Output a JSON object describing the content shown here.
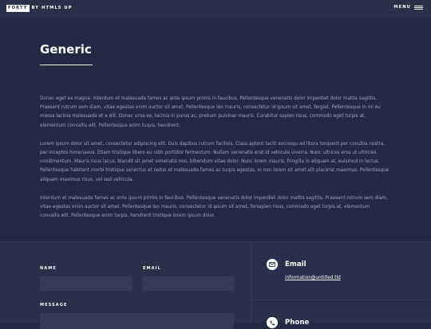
{
  "header": {
    "logo_box": "FORTY",
    "logo_tail": "BY HTML5 UP",
    "menu_label": "MENU"
  },
  "main": {
    "title": "Generic",
    "paragraphs": [
      "Donec eget ex magna. Interdum et malesuada fames ac ante ipsum primis in faucibus. Pellentesque venenatis dolor imperdiet dolor mattis sagittis. Praesent rutrum sem diam, vitae egestas enim auctor sit amet. Pellentesque leo mauris, consectetur id ipsum sit amet, fergiat. Pellentesque in mi eu massa lacinia malesuada et a elit. Donec urna ex, lacinia in purus ac, pretium pulvinar mauris. Curabitur sapien risus, commodo eget turpis at, elementum convallis elit. Pellentesque enim turpis, hendrerit.",
      "Lorem ipsum dolor sit amet, consectetur adipiscing elit. Duis dapibus rutrum facilisis. Class aptent taciti sociosqu ad litora torquent per conubia nostra, per inceptos himenaeos. Etiam tristique libero eu nibh porttitor fermentum. Nullam venenatis erat id vehicula viverra. Nunc ultrices eros ut ultricies condimentum. Mauris risus lacus, blandit sit amet venenatis non, bibendum vitae dolor. Nunc lorem mauris, fringilla in aliquam at, euismod in lectus. Pellentesque habitant morbi tristique senectus et netus et malesuada fames ac turpis egestas. In non lorem sit amet elit placerat maximus. Pellentesque aliquam maximus risus, vel sed vehicula.",
      "Interdum et malesuada fames ac ante ipsum primis in faucibus. Pellentesque venenatis dolor imperdiet dolor mattis sagittis. Praesent rutrum sem diam, vitae egestas enim auctor sit amet. Pellentesque leo mauris, consectetur id ipsum sit amet, fersapien risus, commodo eget turpis at, elementum convallis elit. Pellentesque enim turpis, hendrerit tristique lorem ipsum dolor."
    ]
  },
  "contact": {
    "name_label": "NAME",
    "email_label": "EMAIL",
    "message_label": "MESSAGE",
    "info": [
      {
        "icon": "envelope-icon",
        "title": "Email",
        "link": "information@untitled.tld"
      },
      {
        "icon": "phone-icon",
        "title": "Phone"
      }
    ]
  },
  "colors": {
    "background": "#242943",
    "header_background": "#2a2f4a",
    "input_background": "#353a57",
    "text_primary": "#ffffff",
    "text_muted": "#9fa3bd"
  }
}
